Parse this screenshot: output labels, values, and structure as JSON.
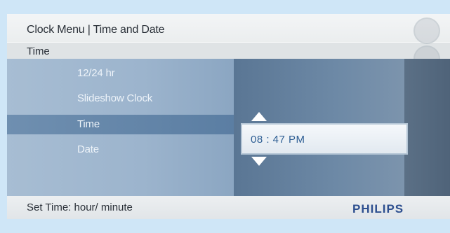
{
  "header": {
    "title": "Clock Menu | Time and  Date",
    "subtitle": "Time"
  },
  "menu": {
    "items": [
      {
        "label": "12/24 hr",
        "selected": false
      },
      {
        "label": "Slideshow Clock",
        "selected": false
      },
      {
        "label": "Time",
        "selected": true
      },
      {
        "label": "Date",
        "selected": false
      }
    ]
  },
  "time_setting": {
    "value": "08 : 47  PM",
    "up_icon": "triangle-up-icon",
    "down_icon": "triangle-down-icon"
  },
  "footer": {
    "hint": "Set Time: hour/ minute",
    "brand": "PHILIPS"
  },
  "colors": {
    "background": "#cfe6f7",
    "menu_panel": "#9cb4cd",
    "selected_row": "#6f8fb0",
    "value_panel": "#5a7694",
    "time_text": "#2f5f94",
    "brand": "#2d4f8f"
  }
}
